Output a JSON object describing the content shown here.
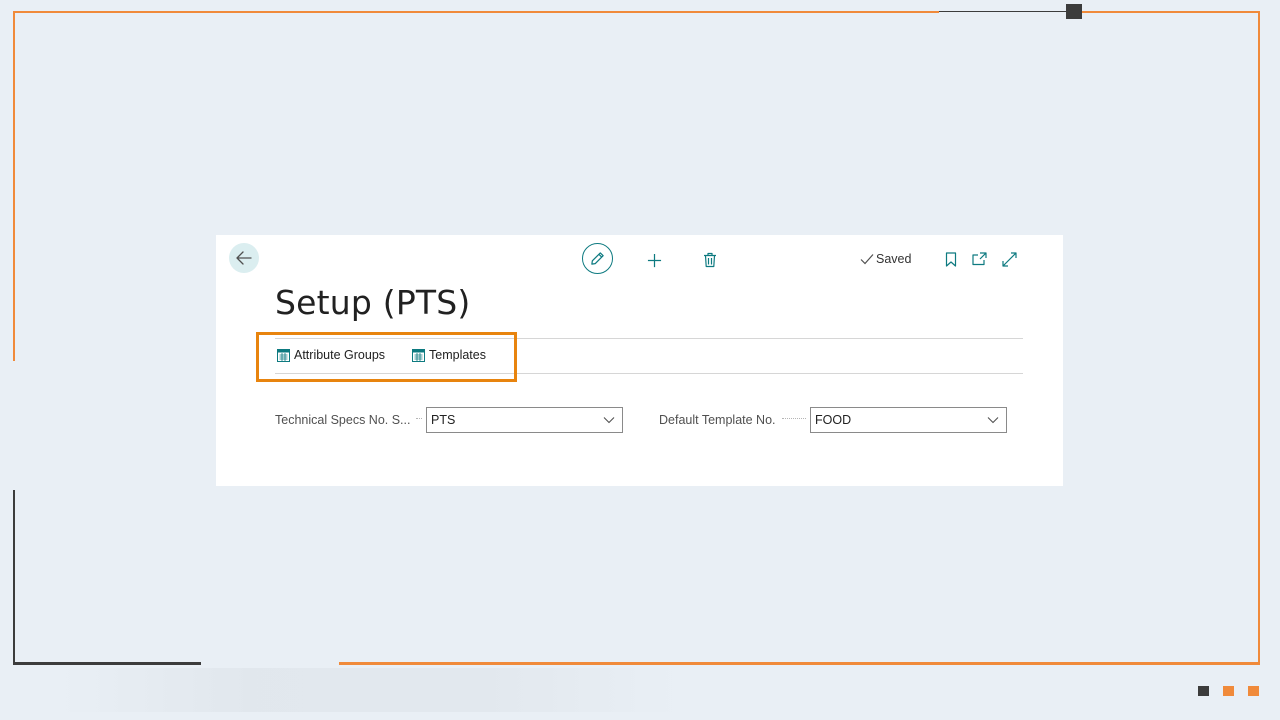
{
  "colors": {
    "frame_orange": "#f08a3a",
    "frame_dark": "#3c3c3c",
    "accent_teal": "#0d7a80",
    "highlight_orange": "#e8840e",
    "slide_background": "#e9eff5"
  },
  "toolbar": {
    "back_icon": "arrow-left-icon",
    "edit_icon": "pencil-icon",
    "new_icon": "plus-icon",
    "delete_icon": "trash-icon",
    "saved_label": "Saved",
    "saved_icon": "checkmark-icon",
    "bookmark_icon": "bookmark-icon",
    "open_new_window_icon": "open-in-new-window-icon",
    "expand_icon": "expand-icon"
  },
  "page": {
    "title": "Setup (PTS)"
  },
  "actions": [
    {
      "label": "Attribute Groups",
      "icon": "list-page-icon"
    },
    {
      "label": "Templates",
      "icon": "list-page-icon"
    }
  ],
  "fields": {
    "technical_specs_no_series": {
      "label": "Technical Specs No. S...",
      "value": "PTS"
    },
    "default_template_no": {
      "label": "Default Template No.",
      "value": "FOOD"
    }
  }
}
